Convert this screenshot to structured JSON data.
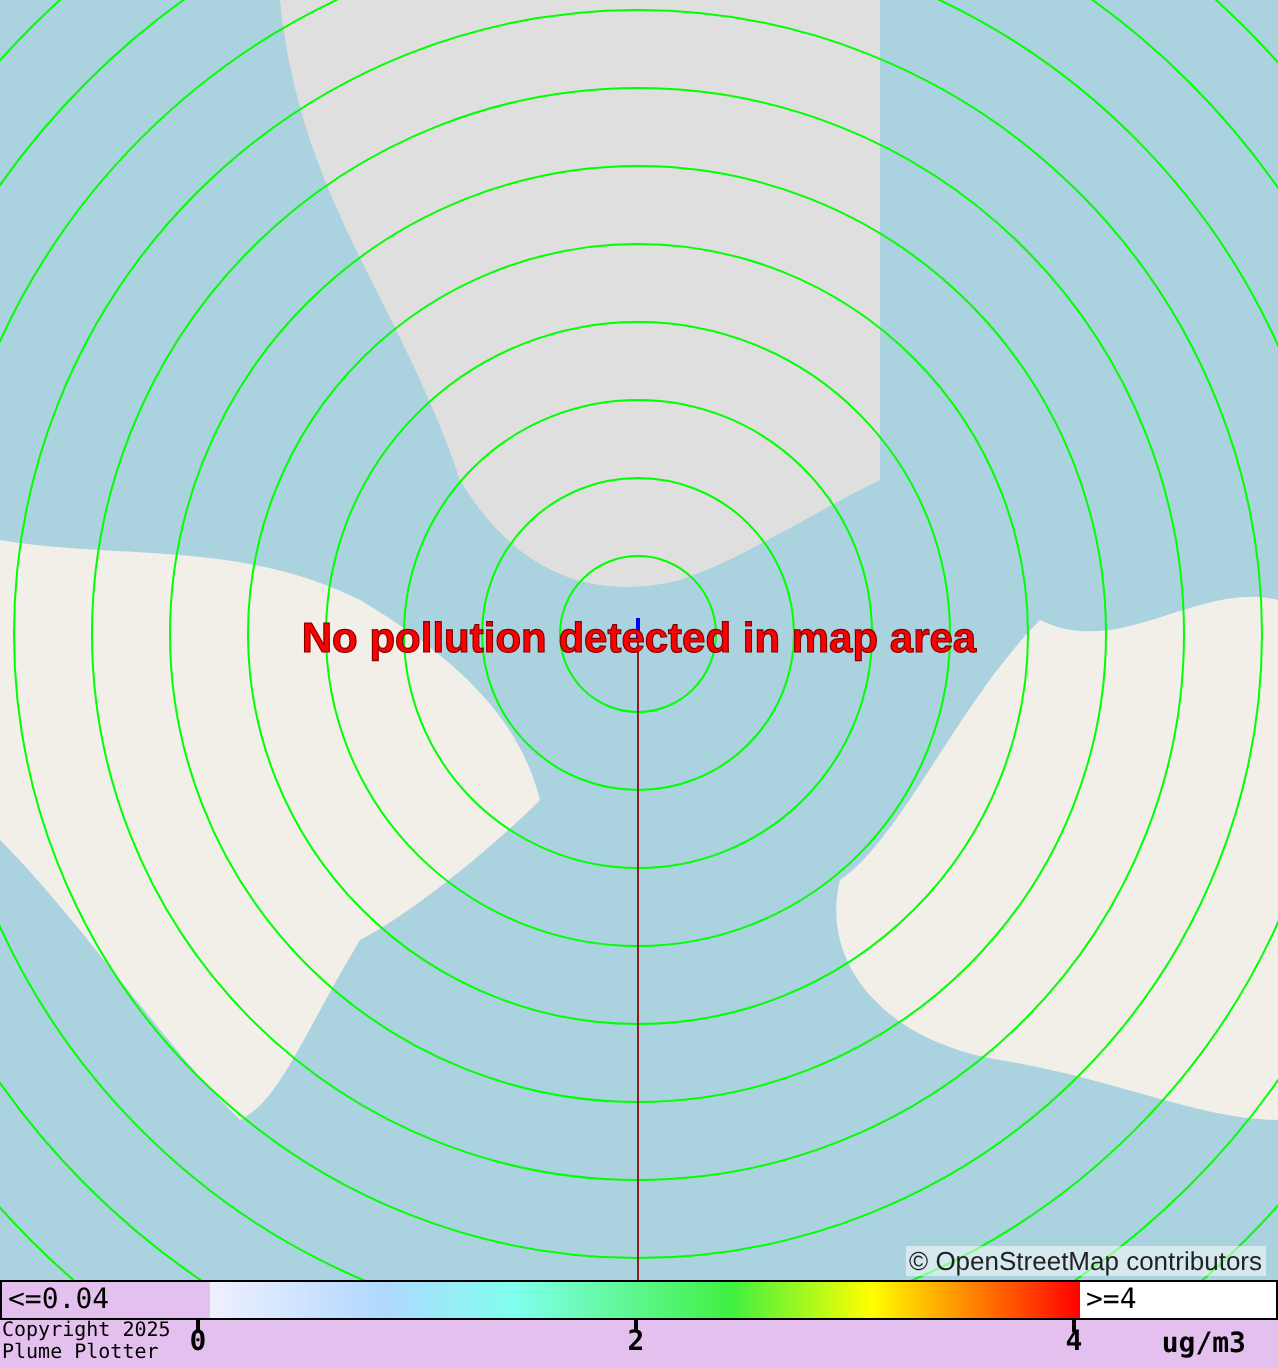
{
  "map": {
    "message": "No pollution detected in map area",
    "attribution": "© OpenStreetMap contributors"
  },
  "legend": {
    "min_label": "<=0.04",
    "max_label": ">=4",
    "ticks": [
      "0",
      "2",
      "4"
    ],
    "unit": "ug/m3",
    "copyright": [
      "Copyright 2025",
      "Plume Plotter"
    ]
  }
}
